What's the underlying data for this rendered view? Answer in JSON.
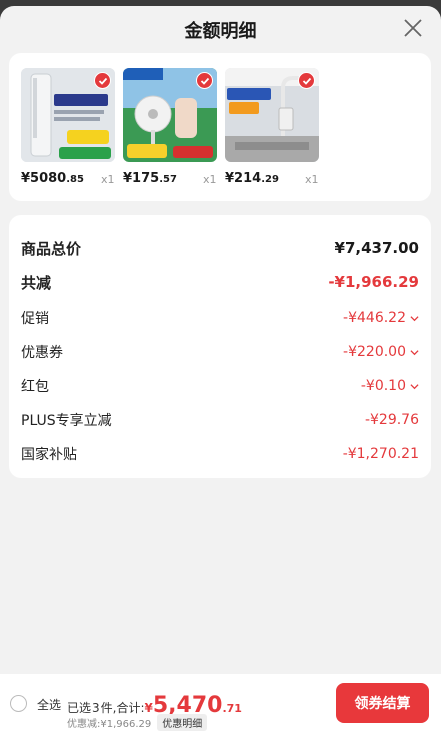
{
  "header": {
    "title": "金额明细"
  },
  "products": [
    {
      "price_int": "¥5080",
      "price_dec": ".85",
      "qty": "x1",
      "image": "air-conditioner"
    },
    {
      "price_int": "¥175",
      "price_dec": ".57",
      "qty": "x1",
      "image": "fan"
    },
    {
      "price_int": "¥214",
      "price_dec": ".29",
      "qty": "x1",
      "image": "water-heater"
    }
  ],
  "summary": {
    "rows": [
      {
        "label": "商品总价",
        "value": "¥7,437.00"
      },
      {
        "label": "共减",
        "value": "-¥1,966.29"
      },
      {
        "label": "促销",
        "value": "-¥446.22"
      },
      {
        "label": "优惠券",
        "value": "-¥220.00"
      },
      {
        "label": "红包",
        "value": "-¥0.10"
      },
      {
        "label": "PLUS专享立减",
        "value": "-¥29.76"
      },
      {
        "label": "国家补贴",
        "value": "-¥1,270.21"
      }
    ]
  },
  "bottom": {
    "select_all": "全选",
    "selected_text": "已选",
    "selected_count": "3",
    "selected_suffix": "件,合计:",
    "currency": "¥",
    "total_int": "5,470",
    "total_dec": ".71",
    "discount_text": "优惠减:¥1,966.29",
    "detail_link": "优惠明细",
    "checkout_label": "领券结算"
  },
  "colors": {
    "accent": "#e4393c",
    "background": "#f2f2f2"
  }
}
